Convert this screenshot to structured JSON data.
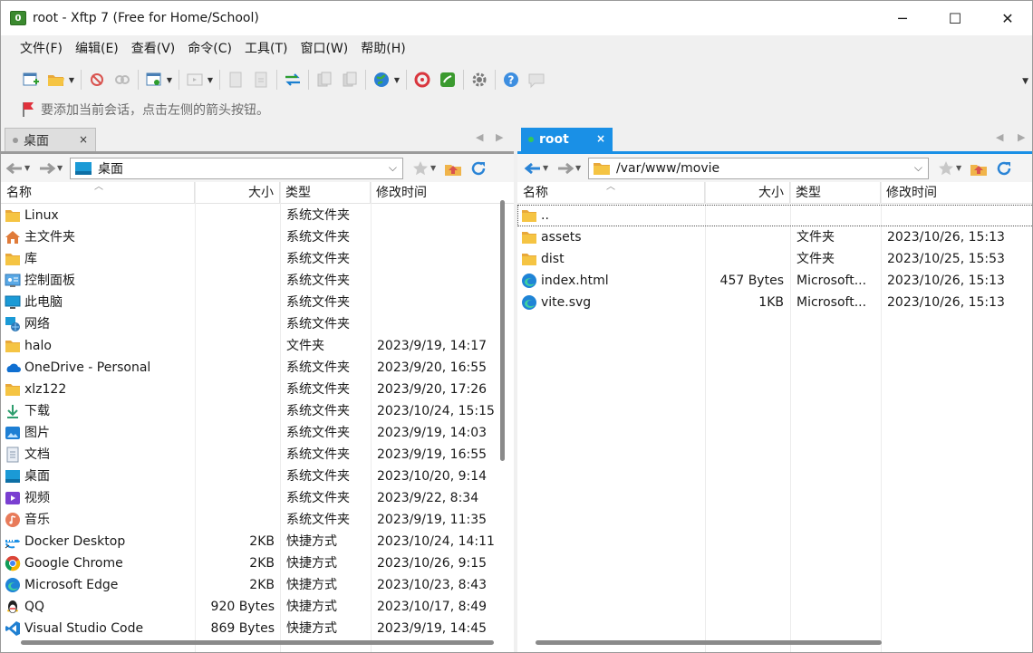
{
  "window": {
    "title": "root - Xftp 7 (Free for Home/School)",
    "app_icon_label": "0",
    "controls": {
      "minimize": "─",
      "maximize": "☐",
      "close": "✕"
    }
  },
  "menu": [
    "文件(F)",
    "编辑(E)",
    "查看(V)",
    "命令(C)",
    "工具(T)",
    "窗口(W)",
    "帮助(H)"
  ],
  "hint": "要添加当前会话，点击左侧的箭头按钮。",
  "colors": {
    "accent": "#1a90e6",
    "folder": "#f5c443",
    "tab_right": "#1a90e6"
  },
  "left": {
    "tab": {
      "label": "桌面",
      "close": "×"
    },
    "address": "桌面",
    "columns": {
      "name": "名称",
      "size": "大小",
      "type": "类型",
      "mtime": "修改时间"
    },
    "rows": [
      {
        "icon": "folder-icon",
        "name": "Linux",
        "size": "",
        "type": "系统文件夹",
        "mtime": ""
      },
      {
        "icon": "home-icon",
        "name": "主文件夹",
        "size": "",
        "type": "系统文件夹",
        "mtime": ""
      },
      {
        "icon": "folder-icon",
        "name": "库",
        "size": "",
        "type": "系统文件夹",
        "mtime": ""
      },
      {
        "icon": "control-panel-icon",
        "name": "控制面板",
        "size": "",
        "type": "系统文件夹",
        "mtime": ""
      },
      {
        "icon": "computer-icon",
        "name": "此电脑",
        "size": "",
        "type": "系统文件夹",
        "mtime": ""
      },
      {
        "icon": "network-icon",
        "name": "网络",
        "size": "",
        "type": "系统文件夹",
        "mtime": ""
      },
      {
        "icon": "folder-icon",
        "name": "halo",
        "size": "",
        "type": "文件夹",
        "mtime": "2023/9/19, 14:17"
      },
      {
        "icon": "onedrive-icon",
        "name": "OneDrive - Personal",
        "size": "",
        "type": "系统文件夹",
        "mtime": "2023/9/20, 16:55"
      },
      {
        "icon": "folder-icon",
        "name": "xlz122",
        "size": "",
        "type": "系统文件夹",
        "mtime": "2023/9/20, 17:26"
      },
      {
        "icon": "download-icon",
        "name": "下载",
        "size": "",
        "type": "系统文件夹",
        "mtime": "2023/10/24, 15:15"
      },
      {
        "icon": "pictures-icon",
        "name": "图片",
        "size": "",
        "type": "系统文件夹",
        "mtime": "2023/9/19, 14:03"
      },
      {
        "icon": "documents-icon",
        "name": "文档",
        "size": "",
        "type": "系统文件夹",
        "mtime": "2023/9/19, 16:55"
      },
      {
        "icon": "desktop-icon",
        "name": "桌面",
        "size": "",
        "type": "系统文件夹",
        "mtime": "2023/10/20, 9:14"
      },
      {
        "icon": "video-icon",
        "name": "视频",
        "size": "",
        "type": "系统文件夹",
        "mtime": "2023/9/22, 8:34"
      },
      {
        "icon": "music-icon",
        "name": "音乐",
        "size": "",
        "type": "系统文件夹",
        "mtime": "2023/9/19, 11:35"
      },
      {
        "icon": "docker-icon",
        "name": "Docker Desktop",
        "size": "2KB",
        "type": "快捷方式",
        "mtime": "2023/10/24, 14:11"
      },
      {
        "icon": "chrome-icon",
        "name": "Google Chrome",
        "size": "2KB",
        "type": "快捷方式",
        "mtime": "2023/10/26, 9:15"
      },
      {
        "icon": "edge-icon",
        "name": "Microsoft Edge",
        "size": "2KB",
        "type": "快捷方式",
        "mtime": "2023/10/23, 8:43"
      },
      {
        "icon": "qq-icon",
        "name": "QQ",
        "size": "920 Bytes",
        "type": "快捷方式",
        "mtime": "2023/10/17, 8:49"
      },
      {
        "icon": "vscode-icon",
        "name": "Visual Studio Code",
        "size": "869 Bytes",
        "type": "快捷方式",
        "mtime": "2023/9/19, 14:45"
      }
    ]
  },
  "right": {
    "tab": {
      "label": "root",
      "close": "×"
    },
    "address": "/var/www/movie",
    "columns": {
      "name": "名称",
      "size": "大小",
      "type": "类型",
      "mtime": "修改时间"
    },
    "rows": [
      {
        "icon": "folder-up-icon",
        "name": "..",
        "size": "",
        "type": "",
        "mtime": ""
      },
      {
        "icon": "folder-icon",
        "name": "assets",
        "size": "",
        "type": "文件夹",
        "mtime": "2023/10/26, 15:13"
      },
      {
        "icon": "folder-icon",
        "name": "dist",
        "size": "",
        "type": "文件夹",
        "mtime": "2023/10/25, 15:53"
      },
      {
        "icon": "edge-icon",
        "name": "index.html",
        "size": "457 Bytes",
        "type": "Microsoft...",
        "mtime": "2023/10/26, 15:13"
      },
      {
        "icon": "edge-icon",
        "name": "vite.svg",
        "size": "1KB",
        "type": "Microsoft...",
        "mtime": "2023/10/26, 15:13"
      }
    ]
  }
}
